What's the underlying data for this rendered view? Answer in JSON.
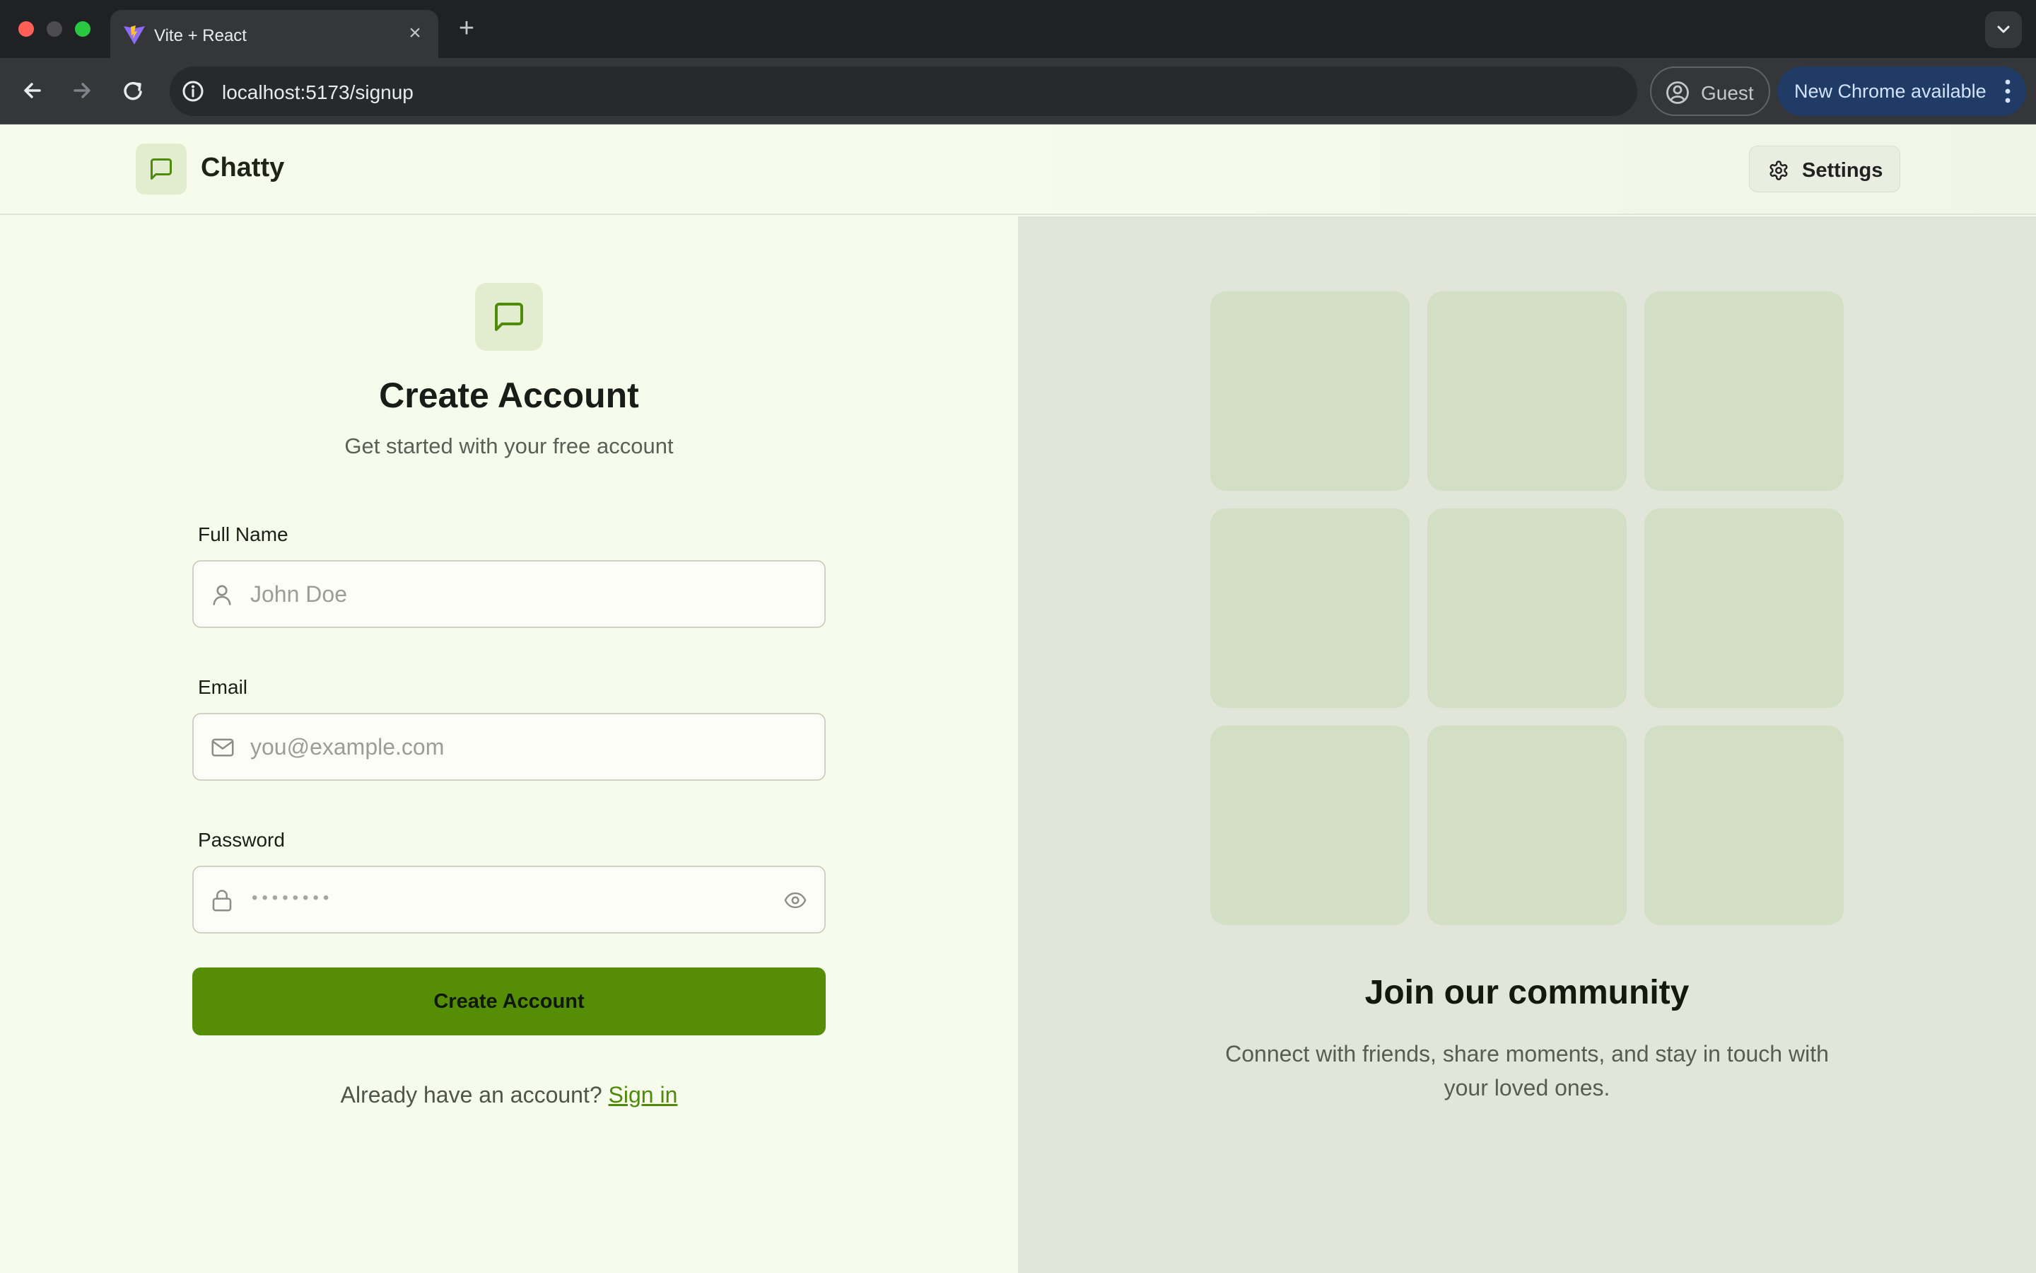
{
  "browser": {
    "tab_title": "Vite + React",
    "url": "localhost:5173/signup",
    "profile_label": "Guest",
    "update_label": "New Chrome available"
  },
  "header": {
    "brand": "Chatty",
    "settings_label": "Settings"
  },
  "form": {
    "title": "Create Account",
    "subtitle": "Get started with your free account",
    "full_name": {
      "label": "Full Name",
      "placeholder": "John Doe"
    },
    "email": {
      "label": "Email",
      "placeholder": "you@example.com"
    },
    "password": {
      "label": "Password",
      "placeholder": "••••••••"
    },
    "submit_label": "Create Account",
    "signin_prompt": "Already have an account?",
    "signin_link": "Sign in"
  },
  "promo": {
    "title": "Join our community",
    "text": "Connect with friends, share moments, and stay in touch with your loved ones."
  },
  "colors": {
    "accent": "#558d04",
    "page_bg": "#f7fbec",
    "panel_bg": "#e2e5da",
    "tile": "#d3dfc4"
  }
}
